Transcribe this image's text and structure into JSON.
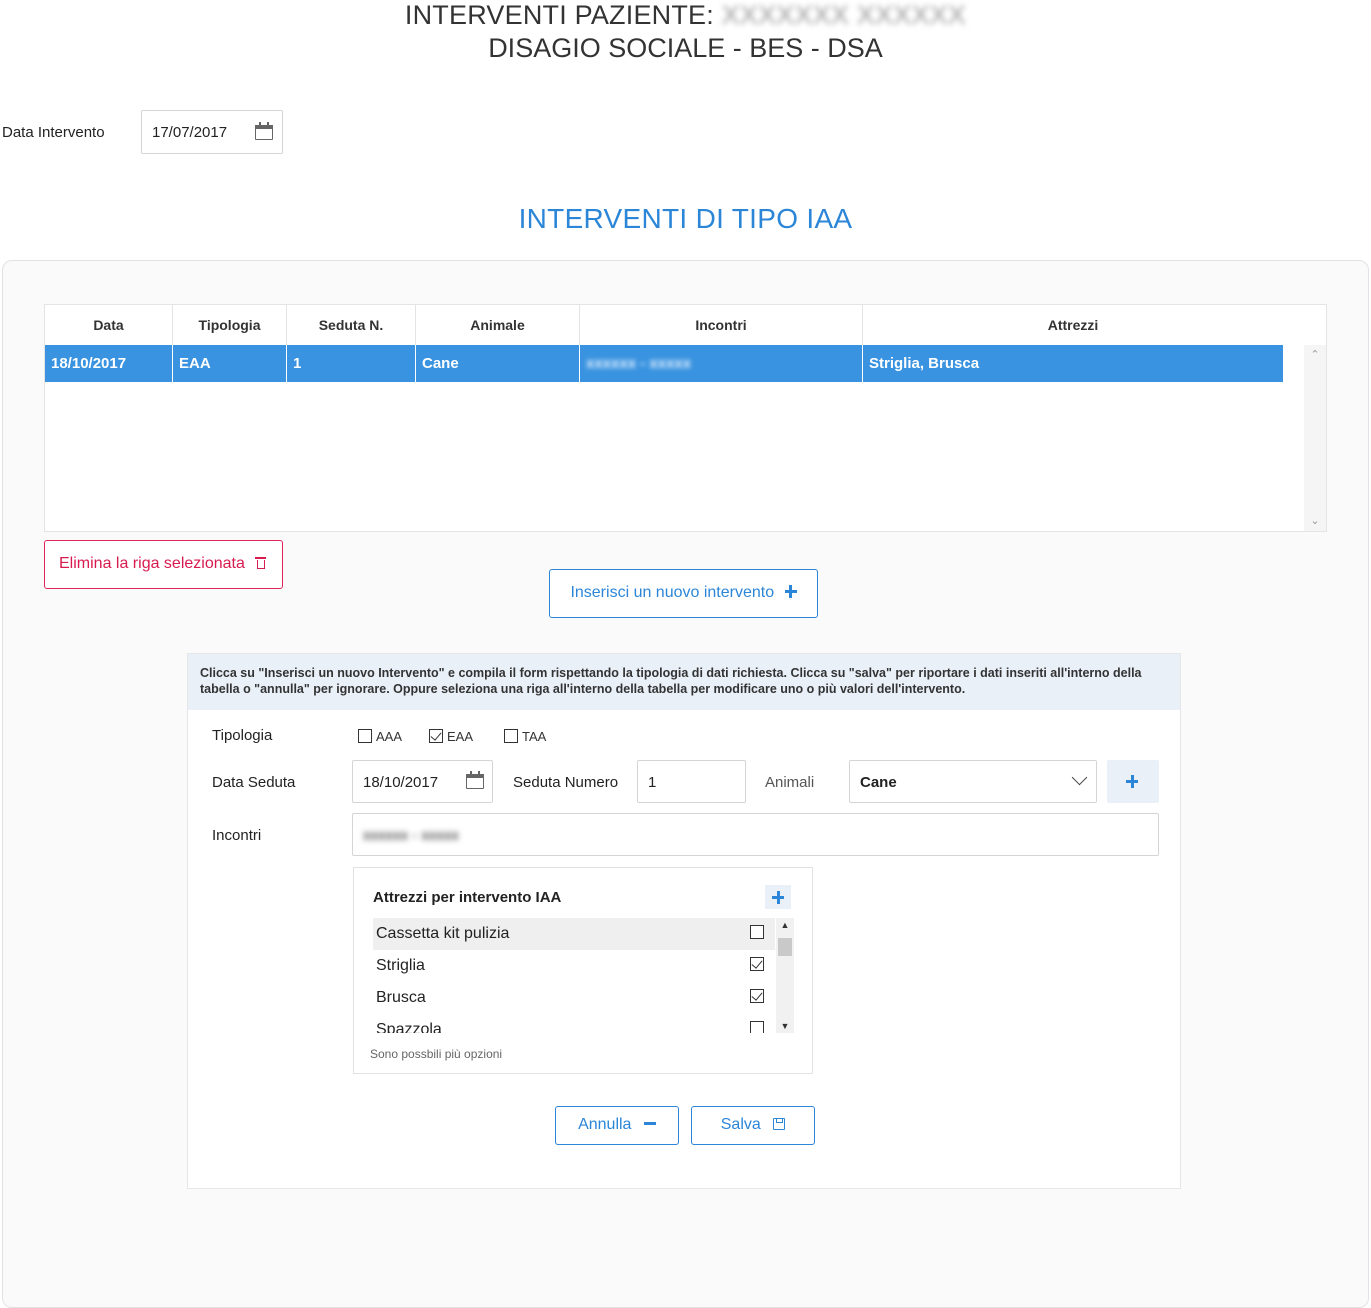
{
  "header": {
    "title_prefix": "INTERVENTI PAZIENTE:",
    "patient_name": "XXXXXXX XXXXXX",
    "subtitle": "DISAGIO SOCIALE - BES - DSA"
  },
  "data_intervento": {
    "label": "Data Intervento",
    "value": "17/07/2017"
  },
  "section_title": "INTERVENTI DI TIPO IAA",
  "table": {
    "columns": [
      "Data",
      "Tipologia",
      "Seduta N.",
      "Animale",
      "Incontri",
      "Attrezzi"
    ],
    "rows": [
      {
        "data": "18/10/2017",
        "tipologia": "EAA",
        "seduta": "1",
        "animale": "Cane",
        "incontri": "xxxxxx - xxxxx",
        "attrezzi": "Striglia, Brusca",
        "selected": true
      }
    ]
  },
  "buttons": {
    "delete": "Elimina la riga selezionata",
    "new": "Inserisci un nuovo intervento",
    "cancel": "Annulla",
    "save": "Salva"
  },
  "form": {
    "info": "Clicca su \"Inserisci un nuovo Intervento\" e compila il form rispettando la tipologia di dati richiesta. Clicca su \"salva\" per riportare i dati inseriti all'interno della tabella o \"annulla\" per ignorare. Oppure seleziona una riga all'interno della tabella per modificare uno o più valori dell'intervento.",
    "tipologia": {
      "label": "Tipologia",
      "options": [
        {
          "label": "AAA",
          "checked": false
        },
        {
          "label": "EAA",
          "checked": true
        },
        {
          "label": "TAA",
          "checked": false
        }
      ]
    },
    "data_seduta": {
      "label": "Data Seduta",
      "value": "18/10/2017"
    },
    "seduta_numero": {
      "label": "Seduta Numero",
      "value": "1"
    },
    "animali": {
      "label": "Animali",
      "value": "Cane"
    },
    "incontri": {
      "label": "Incontri",
      "value": "xxxxxx - xxxxx"
    },
    "attrezzi": {
      "title": "Attrezzi per intervento IAA",
      "items": [
        {
          "label": "Cassetta kit pulizia",
          "checked": false
        },
        {
          "label": "Striglia",
          "checked": true
        },
        {
          "label": "Brusca",
          "checked": true
        },
        {
          "label": "Spazzola",
          "checked": false
        }
      ],
      "hint": "Sono possbili più opzioni"
    }
  },
  "colors": {
    "accent": "#2b86d8",
    "selected_row": "#3993e0",
    "danger": "#d81b4f",
    "info_bg": "#e9f0f8"
  }
}
